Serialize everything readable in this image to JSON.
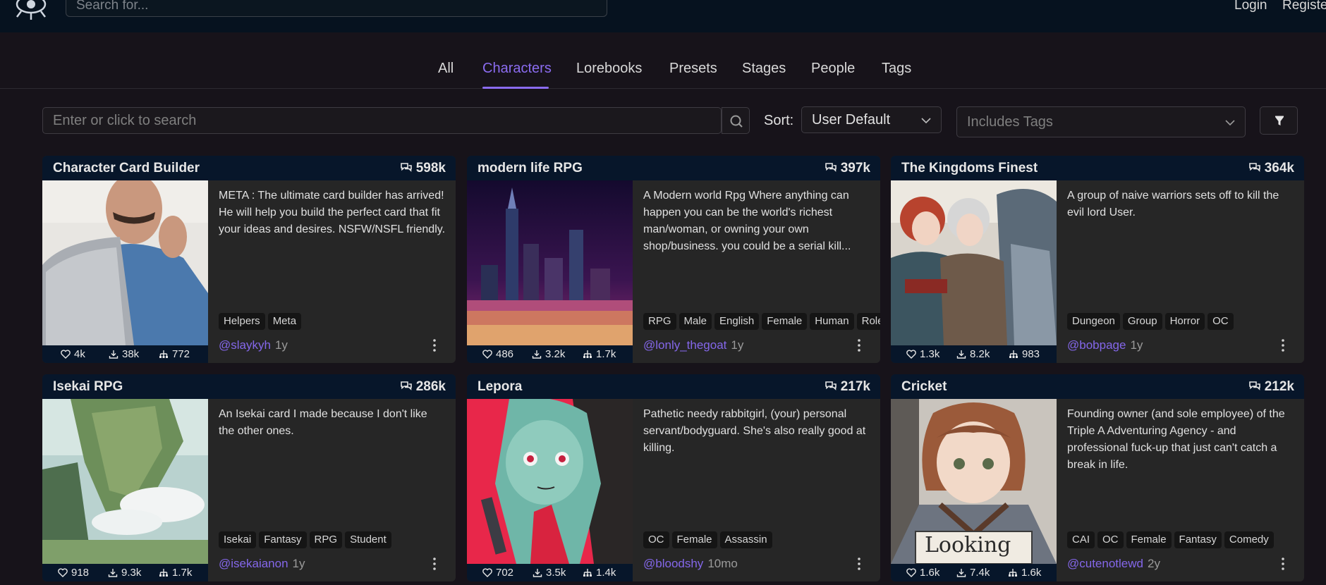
{
  "header": {
    "search_placeholder": "Search for...",
    "login_label": "Login",
    "register_label": "Registe"
  },
  "tabs": [
    {
      "label": "All"
    },
    {
      "label": "Characters",
      "active": true
    },
    {
      "label": "Lorebooks"
    },
    {
      "label": "Presets"
    },
    {
      "label": "Stages"
    },
    {
      "label": "People"
    },
    {
      "label": "Tags"
    }
  ],
  "filters": {
    "search_placeholder": "Enter or click to search",
    "sort_label": "Sort:",
    "sort_value": "User Default",
    "tags_placeholder": "Includes Tags"
  },
  "accent_color": "#8b6cf0",
  "cards": [
    {
      "title": "Character Card Builder",
      "count": "598k",
      "description": "META : The ultimate card builder has arrived! He will help you build the perfect card that fit your ideas and desires. NSFW/NSFL friendly.",
      "tags": [
        "Helpers",
        "Meta"
      ],
      "author": "@slaykyh",
      "age": "1y",
      "favorites": "4k",
      "downloads": "38k",
      "forks": "772"
    },
    {
      "title": "modern life RPG",
      "count": "397k",
      "description": "A Modern world Rpg Where anything can happen you can be the world's richest man/woman, or owning your own shop/business. you could be a serial kill...",
      "tags": [
        "RPG",
        "Male",
        "English",
        "Female",
        "Human",
        "Role"
      ],
      "author": "@lonly_thegoat",
      "age": "1y",
      "favorites": "486",
      "downloads": "3.2k",
      "forks": "1.7k"
    },
    {
      "title": "The Kingdoms Finest",
      "count": "364k",
      "description": "A group of naive warriors sets off to kill the evil lord User.",
      "tags": [
        "Dungeon",
        "Group",
        "Horror",
        "OC"
      ],
      "author": "@bobpage",
      "age": "1y",
      "favorites": "1.3k",
      "downloads": "8.2k",
      "forks": "983"
    },
    {
      "title": "Isekai RPG",
      "count": "286k",
      "description": "An Isekai card I made because I don't like the other ones.",
      "tags": [
        "Isekai",
        "Fantasy",
        "RPG",
        "Student"
      ],
      "author": "@isekaianon",
      "age": "1y",
      "favorites": "918",
      "downloads": "9.3k",
      "forks": "1.7k"
    },
    {
      "title": "Lepora",
      "count": "217k",
      "description": "Pathetic needy rabbitgirl, (your) personal servant/bodyguard. She's also really good at killing.",
      "tags": [
        "OC",
        "Female",
        "Assassin"
      ],
      "author": "@bloodshy",
      "age": "10mo",
      "favorites": "702",
      "downloads": "3.5k",
      "forks": "1.4k"
    },
    {
      "title": "Cricket",
      "count": "212k",
      "description": "Founding owner (and sole employee) of the Triple A Adventuring Agency - and professional fuck-up that just can't catch a break in life.",
      "tags": [
        "CAI",
        "OC",
        "Female",
        "Fantasy",
        "Comedy"
      ],
      "author": "@cutenotlewd",
      "age": "2y",
      "favorites": "1.6k",
      "downloads": "7.4k",
      "forks": "1.6k",
      "image_text": "Looking"
    }
  ]
}
